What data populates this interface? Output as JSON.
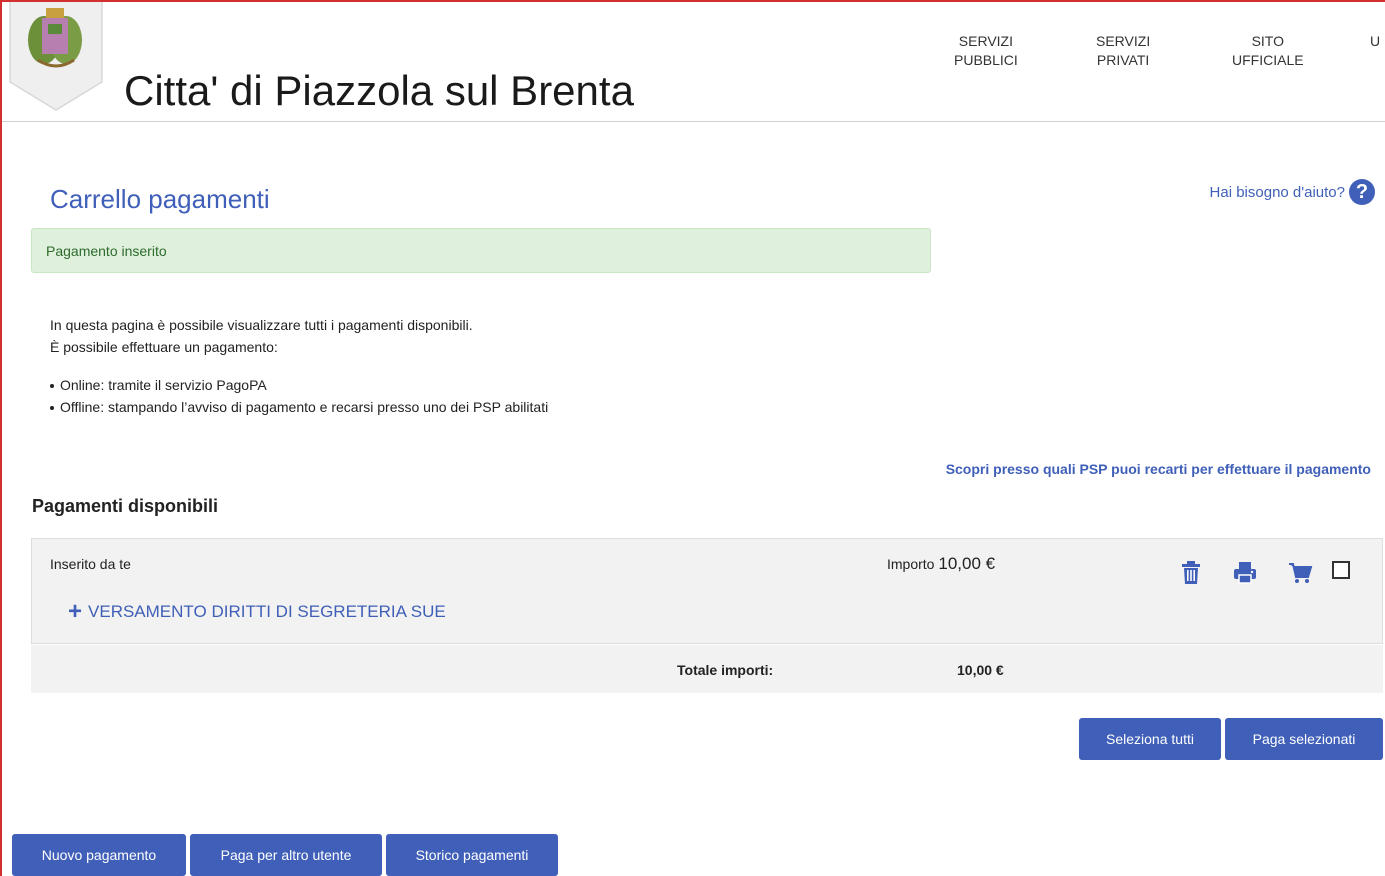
{
  "header": {
    "site_title": "Citta' di Piazzola sul Brenta",
    "nav": [
      {
        "line1": "SERVIZI",
        "line2": "PUBBLICI"
      },
      {
        "line1": "SERVIZI",
        "line2": "PRIVATI"
      },
      {
        "line1": "SITO",
        "line2": "UFFICIALE"
      },
      {
        "line1": "U",
        "line2": ""
      }
    ]
  },
  "page": {
    "title": "Carrello pagamenti",
    "help_label": "Hai bisogno d'aiuto?",
    "help_icon": "?",
    "alert": "Pagamento inserito",
    "intro_1": "In questa pagina è possibile visualizzare tutti i pagamenti disponibili.",
    "intro_2": "È possibile effettuare un pagamento:",
    "bullets": [
      "Online: tramite il servizio PagoPA",
      "Offline: stampando l’avviso di pagamento e recarsi presso uno dei PSP abilitati"
    ],
    "psp_link": "Scopri presso quali PSP puoi recarti per effettuare il pagamento",
    "section_title": "Pagamenti disponibili"
  },
  "payment": {
    "inserted_by": "Inserito da te",
    "amount_label": "Importo",
    "amount_value": "10,00 €",
    "service_icon": "+",
    "service_name": "VERSAMENTO DIRITTI DI SEGRETERIA SUE",
    "actions": [
      "trash-icon",
      "print-icon",
      "cart-icon"
    ],
    "selected": false
  },
  "totals": {
    "label": "Totale importi:",
    "value": "10,00 €"
  },
  "buttons": {
    "select_all": "Seleziona tutti",
    "pay_selected": "Paga selezionati",
    "new_payment": "Nuovo pagamento",
    "pay_other": "Paga per altro utente",
    "history": "Storico pagamenti"
  },
  "colors": {
    "accent": "#3f5fb8",
    "alert_bg": "#dff0dc",
    "frame": "#d32f2f"
  }
}
